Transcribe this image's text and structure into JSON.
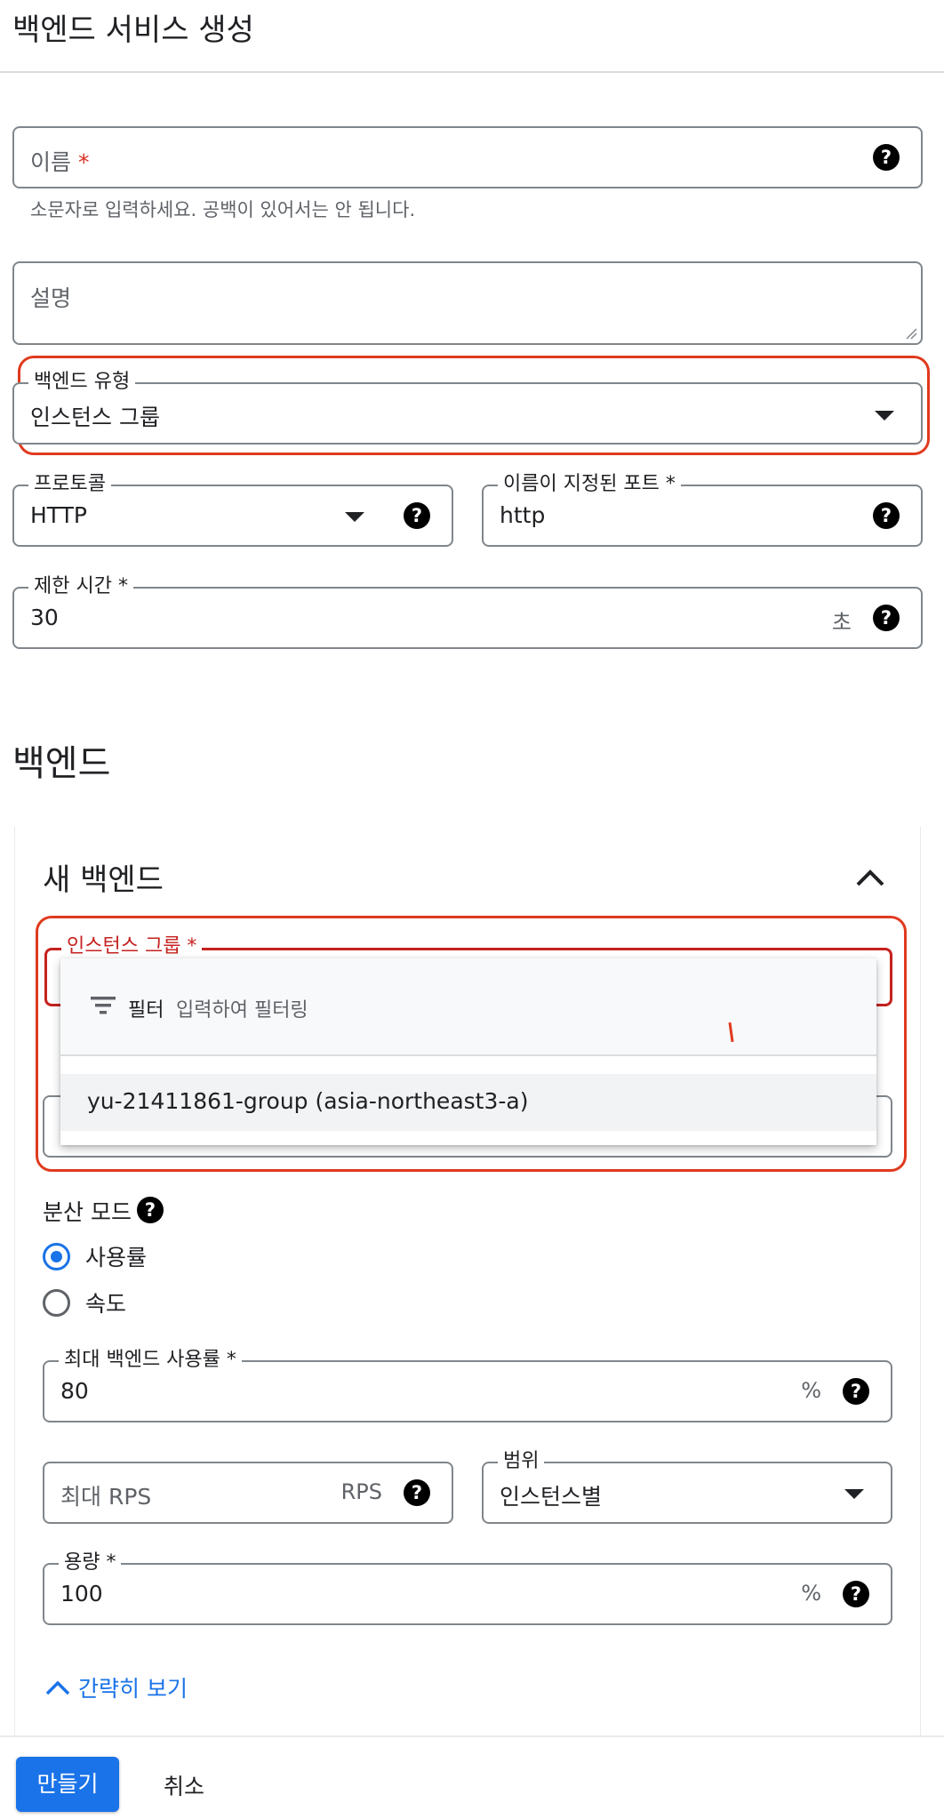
{
  "page": {
    "title": "백엔드 서비스 생성"
  },
  "form": {
    "name": {
      "label": "이름",
      "required": "*",
      "hint": "소문자로 입력하세요. 공백이 있어서는 안 됩니다."
    },
    "description": {
      "placeholder": "설명"
    },
    "backend_type": {
      "label": "백엔드 유형",
      "value": "인스턴스 그룹"
    },
    "protocol": {
      "label": "프로토콜",
      "value": "HTTP"
    },
    "named_port": {
      "label": "이름이 지정된 포트 *",
      "value": "http"
    },
    "timeout": {
      "label": "제한 시간 *",
      "value": "30",
      "unit": "초"
    }
  },
  "backends": {
    "heading": "백엔드",
    "new_backend": {
      "title": "새 백엔드",
      "instance_group": {
        "label": "인스턴스 그룹 *",
        "dropdown": {
          "filter_label": "필터",
          "filter_placeholder": "입력하여 필터링",
          "options": [
            "yu-21411861-group (asia-northeast3-a)"
          ]
        }
      },
      "balancing_mode": {
        "label": "분산 모드",
        "options": [
          {
            "label": "사용률",
            "selected": true
          },
          {
            "label": "속도",
            "selected": false
          }
        ]
      },
      "max_utilization": {
        "label": "최대 백엔드 사용률 *",
        "value": "80",
        "unit": "%"
      },
      "max_rps": {
        "placeholder": "최대 RPS",
        "unit": "RPS"
      },
      "scope": {
        "label": "범위",
        "value": "인스턴스별"
      },
      "capacity": {
        "label": "용량 *",
        "value": "100",
        "unit": "%"
      },
      "collapse_link": "간략히 보기"
    }
  },
  "footer": {
    "create_label": "만들기",
    "cancel_label": "취소"
  },
  "colors": {
    "accent": "#1a73e8",
    "highlight_red": "#e03a1e",
    "error_red": "#d93025"
  },
  "icons": {
    "help": "help-circle-icon",
    "dropdown": "arrow-drop-down-icon",
    "collapse": "chevron-up-icon",
    "filter": "filter-list-icon"
  }
}
